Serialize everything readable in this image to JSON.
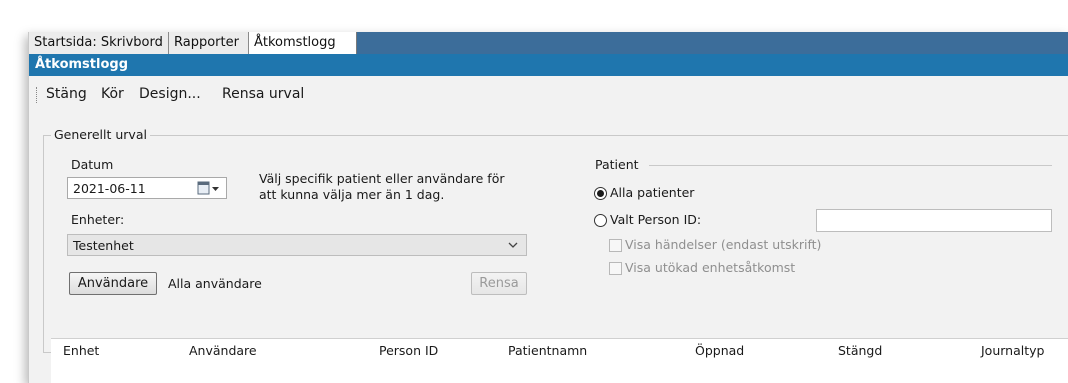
{
  "tabs": [
    {
      "label": "Startsida: Skrivbord",
      "active": false
    },
    {
      "label": "Rapporter",
      "active": false
    },
    {
      "label": "Åtkomstlogg",
      "active": true
    }
  ],
  "title": "Åtkomstlogg",
  "toolbar": {
    "close": "Stäng",
    "run": "Kör",
    "design": "Design...",
    "clear": "Rensa urval"
  },
  "general": {
    "legend": "Generellt urval",
    "date_label": "Datum",
    "date_value": "2021-06-11",
    "hint": "Välj specifik patient eller användare för att kunna välja mer än 1 dag.",
    "units_label": "Enheter:",
    "units_value": "Testenhet",
    "users_button": "Användare",
    "users_value": "Alla användare",
    "clear_button": "Rensa"
  },
  "patient": {
    "legend": "Patient",
    "all": "Alla patienter",
    "selected": "Valt Person ID:",
    "person_id_value": "",
    "show_events": "Visa händelser (endast utskrift)",
    "show_extended": "Visa utökad enhetsåtkomst"
  },
  "table": {
    "columns": [
      "Enhet",
      "Användare",
      "Person ID",
      "Patientnamn",
      "Öppnad",
      "Stängd",
      "Journaltyp"
    ]
  },
  "colors": {
    "tabstrip": "#3c6d9a",
    "titlebar": "#1f76ae",
    "window_bg": "#f2f2f2"
  }
}
